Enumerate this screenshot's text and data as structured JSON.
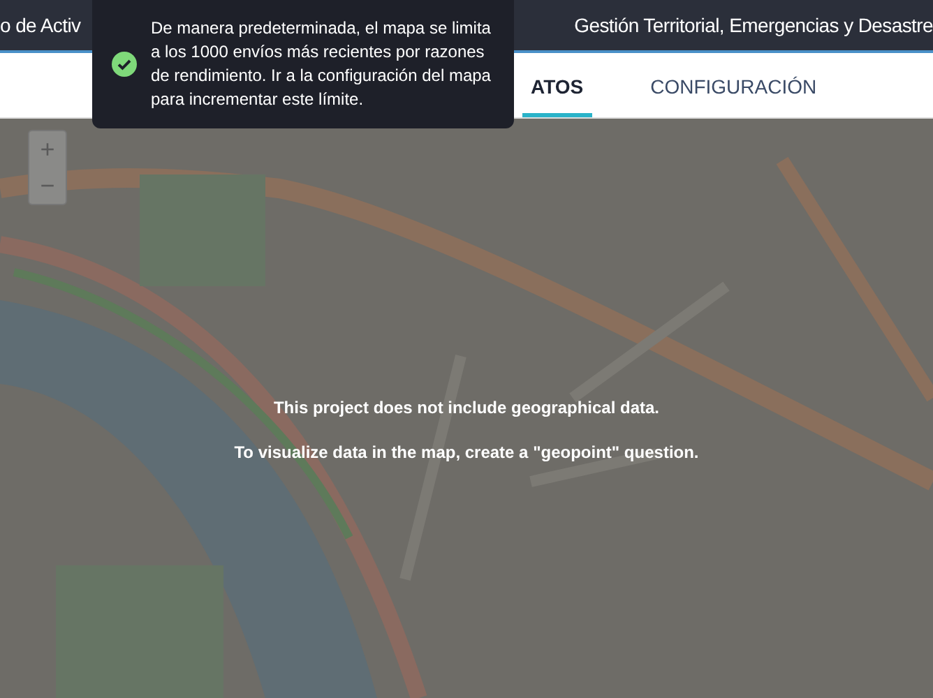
{
  "header": {
    "title_parts": [
      "o de Activ",
      "Gestión Territorial, Emergencias y Desastre"
    ]
  },
  "tabs": [
    {
      "label": "ATOS",
      "selected": true
    },
    {
      "label": "CONFIGURACIÓN",
      "selected": false
    }
  ],
  "toast": {
    "kind": "success",
    "message": "De manera predeterminada, el mapa se limita a los 1000 envíos más recientes por razones de rendimiento. Ir a la configuración del mapa para incrementar este límite."
  },
  "map": {
    "zoom_controls": [
      "+",
      "−"
    ],
    "messages": [
      "This project does not include geographical data.",
      "To visualize data in the map, create a \"geopoint\" question."
    ]
  }
}
